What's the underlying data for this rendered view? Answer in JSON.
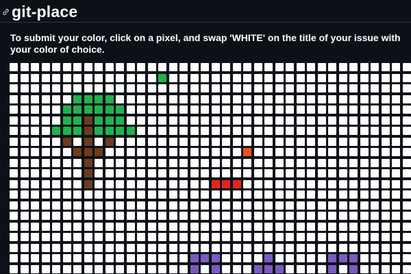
{
  "header": {
    "title": "git-place",
    "link_icon": "link-icon"
  },
  "instructions": "To submit your color, click on a pixel, and swap 'WHITE' on the title of your issue with your color of choice.",
  "canvas": {
    "default_color": "WHITE",
    "palette": {
      "W": "#ffffff",
      "G": "#1fb34d",
      "B": "#6b3c1f",
      "O": "#e9531a",
      "R": "#e8231d",
      "P": "#7b5cc0"
    },
    "rows": [
      "WWWWWWWWWWWWWWWWWWWWWWWWWWWWWWWWWWWWWW",
      "WWWWWWWWWWWWWWGWWWWWWWWWWWWWWWWWWWWWWW",
      "WWWWWWWWWWWWWWWWWWWWWWWWWWWWWWWWWWWWWW",
      "WWWWWWGGGGWWWWWWWWWWWWWWWWWWWWWWWWWWWW",
      "WWWWWGGGGGGWWWWWWWWWWWWWWWWWWWWWWWWWWW",
      "WWWWWGGBGGGWWWWWWWWWWWWWWWWWWWWWWWWWWW",
      "WWWWGGGBGGGGWWWWWWWWWWWWWWWWWWWWWWWWWW",
      "WWWWWBWBWBWWWWWWWWWWWWWWWWWWWWWWWWWWWW",
      "WWWWWWBBBWWWWWWWWWWWWWOWWWWWWWWWWWWWWW",
      "WWWWWWWBWWWWWWWWWWWWWWWWWWWWWWWWWWWWWW",
      "WWWWWWWBWWWWWWWWWWWWWWWWWWWWWWWWWWWWWW",
      "WWWWWWWBWWWWWWWWWWWRRRWWWWWWWWWWWWWWWW",
      "WWWWWWWWWWWWWWWWWWWWWWWWWWWWWWWWWWWWWW",
      "WWWWWWWWWWWWWWWWWWWWWWWWWWWWWWWWWWWWWW",
      "WWWWWWWWWWWWWWWWWWWWWWWWWWWWWWWWWWWWWW",
      "WWWWWWWWWWWWWWWWWWWWWWWWWWWWWWWWWWWWWW",
      "WWWWWWWWWWWWWWWWWWWWWWWWWWWWWWWWWWWWWW",
      "WWWWWWWWWWWWWWWWWWWWWWWWWWWWWWWWWWWWWW",
      "WWWWWWWWWWWWWWWWWPPPWWWWPWWWWWPPPWWWWW",
      "WWWWWWWWWWWWWWWWWPWPWWWPPPWWWWPWPWWWWW"
    ]
  }
}
